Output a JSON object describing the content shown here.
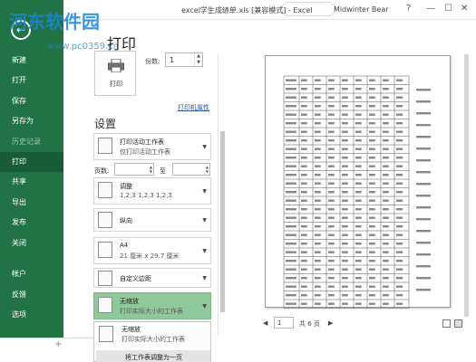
{
  "window": {
    "title": "excel学生成绩单.xls [兼容模式] - Excel",
    "user": "Midwinter Bear",
    "help": "?",
    "minimize": "—",
    "maximize": "☐",
    "close": "✕"
  },
  "watermark": {
    "name": "河东软件园",
    "url": "www.pc0359.cn"
  },
  "sidebar": {
    "back": "←",
    "items": [
      {
        "label": "新建"
      },
      {
        "label": "打开"
      },
      {
        "label": "保存"
      },
      {
        "label": "另存为"
      },
      {
        "label": "历史记录"
      },
      {
        "label": "打印"
      },
      {
        "label": "共享"
      },
      {
        "label": "导出"
      },
      {
        "label": "发布"
      },
      {
        "label": "关闭"
      },
      {
        "label": "帐户"
      },
      {
        "label": "反馈"
      },
      {
        "label": "选项"
      }
    ]
  },
  "print": {
    "title": "打印",
    "button_label": "打印",
    "copies_label": "份数:",
    "copies_value": "1",
    "printer_properties": "打印机属性"
  },
  "settings": {
    "title": "设置",
    "scope": {
      "line1": "打印活动工作表",
      "line2": "仅打印活动工作表"
    },
    "pages_label": "页数:",
    "pages_to": "至",
    "collate": {
      "line1": "调整",
      "line2": "1,2,3    1,2,3    1,2,3"
    },
    "orientation": {
      "line1": "纵向"
    },
    "paper": {
      "line1": "A4",
      "line2": "21 厘米 x 29.7 厘米"
    },
    "margins": {
      "line1": "自定义边距"
    },
    "scaling": {
      "line1": "无缩放",
      "line2": "打印实际大小的工作表"
    }
  },
  "scaling_menu": {
    "options": [
      {
        "line1": "无缩放",
        "line2": "打印实际大小的工作表"
      },
      {
        "line1": "将工作表调整为一页"
      }
    ]
  },
  "preview": {
    "current_page": "1",
    "total_pages": "共 6 页",
    "prev": "◀",
    "next": "▶"
  },
  "sheet": {
    "add": "+"
  }
}
